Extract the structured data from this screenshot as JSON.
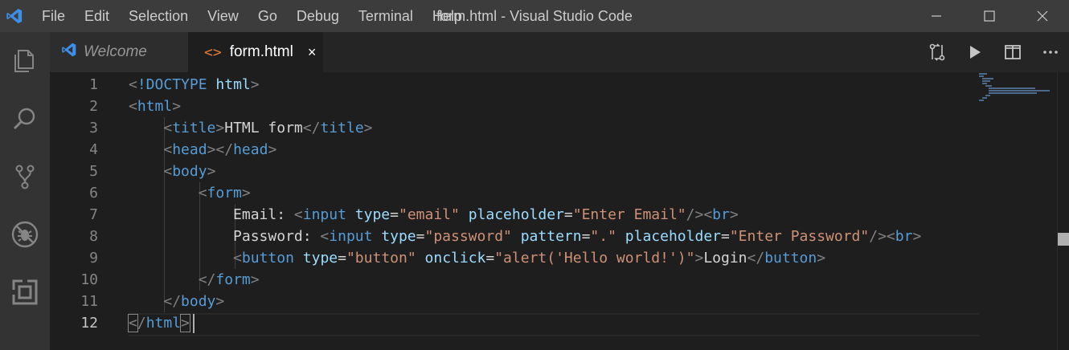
{
  "titlebar": {
    "menu": [
      "File",
      "Edit",
      "Selection",
      "View",
      "Go",
      "Debug",
      "Terminal",
      "Help"
    ],
    "title": "form.html - Visual Studio Code",
    "controls": [
      "minimize-icon",
      "maximize-icon",
      "close-icon"
    ]
  },
  "activitybar": {
    "items": [
      "explorer-icon",
      "search-icon",
      "source-control-icon",
      "debug-icon",
      "extensions-icon"
    ]
  },
  "tabs": [
    {
      "label": "Welcome",
      "icon": "vscode-logo-icon",
      "active": false
    },
    {
      "label": "form.html",
      "icon": "html-file-icon",
      "icon_glyph": "<>",
      "active": true,
      "close": "×"
    }
  ],
  "editor_actions": [
    "open-changes-icon",
    "run-icon",
    "split-editor-icon",
    "more-actions-icon"
  ],
  "editor": {
    "current_line": 12,
    "line_numbers": [
      "1",
      "2",
      "3",
      "4",
      "5",
      "6",
      "7",
      "8",
      "9",
      "10",
      "11",
      "12"
    ],
    "lines": [
      [
        [
          "punc",
          "<"
        ],
        [
          "tag",
          "!DOCTYPE"
        ],
        [
          "text",
          " "
        ],
        [
          "attr",
          "html"
        ],
        [
          "punc",
          ">"
        ]
      ],
      [
        [
          "punc",
          "<"
        ],
        [
          "tag",
          "html"
        ],
        [
          "punc",
          ">"
        ]
      ],
      [
        [
          "text",
          "    "
        ],
        [
          "punc",
          "<"
        ],
        [
          "tag",
          "title"
        ],
        [
          "punc",
          ">"
        ],
        [
          "text",
          "HTML form"
        ],
        [
          "punc",
          "</"
        ],
        [
          "tag",
          "title"
        ],
        [
          "punc",
          ">"
        ]
      ],
      [
        [
          "text",
          "    "
        ],
        [
          "punc",
          "<"
        ],
        [
          "tag",
          "head"
        ],
        [
          "punc",
          "></"
        ],
        [
          "tag",
          "head"
        ],
        [
          "punc",
          ">"
        ]
      ],
      [
        [
          "text",
          "    "
        ],
        [
          "punc",
          "<"
        ],
        [
          "tag",
          "body"
        ],
        [
          "punc",
          ">"
        ]
      ],
      [
        [
          "text",
          "        "
        ],
        [
          "punc",
          "<"
        ],
        [
          "tag",
          "form"
        ],
        [
          "punc",
          ">"
        ]
      ],
      [
        [
          "text",
          "            Email: "
        ],
        [
          "punc",
          "<"
        ],
        [
          "tag",
          "input"
        ],
        [
          "text",
          " "
        ],
        [
          "attr",
          "type"
        ],
        [
          "text",
          "="
        ],
        [
          "str",
          "\"email\""
        ],
        [
          "text",
          " "
        ],
        [
          "attr",
          "placeholder"
        ],
        [
          "text",
          "="
        ],
        [
          "str",
          "\"Enter Email\""
        ],
        [
          "punc",
          "/><"
        ],
        [
          "tag",
          "br"
        ],
        [
          "punc",
          ">"
        ]
      ],
      [
        [
          "text",
          "            Password: "
        ],
        [
          "punc",
          "<"
        ],
        [
          "tag",
          "input"
        ],
        [
          "text",
          " "
        ],
        [
          "attr",
          "type"
        ],
        [
          "text",
          "="
        ],
        [
          "str",
          "\"password\""
        ],
        [
          "text",
          " "
        ],
        [
          "attr",
          "pattern"
        ],
        [
          "text",
          "="
        ],
        [
          "str",
          "\".\""
        ],
        [
          "text",
          " "
        ],
        [
          "attr",
          "placeholder"
        ],
        [
          "text",
          "="
        ],
        [
          "str",
          "\"Enter Password\""
        ],
        [
          "punc",
          "/><"
        ],
        [
          "tag",
          "br"
        ],
        [
          "punc",
          ">"
        ]
      ],
      [
        [
          "text",
          "            "
        ],
        [
          "punc",
          "<"
        ],
        [
          "tag",
          "button"
        ],
        [
          "text",
          " "
        ],
        [
          "attr",
          "type"
        ],
        [
          "text",
          "="
        ],
        [
          "str",
          "\"button\""
        ],
        [
          "text",
          " "
        ],
        [
          "attr",
          "onclick"
        ],
        [
          "text",
          "="
        ],
        [
          "str",
          "\"alert('Hello world!')\""
        ],
        [
          "punc",
          ">"
        ],
        [
          "text",
          "Login"
        ],
        [
          "punc",
          "</"
        ],
        [
          "tag",
          "button"
        ],
        [
          "punc",
          ">"
        ]
      ],
      [
        [
          "text",
          "        "
        ],
        [
          "punc",
          "</"
        ],
        [
          "tag",
          "form"
        ],
        [
          "punc",
          ">"
        ]
      ],
      [
        [
          "text",
          "    "
        ],
        [
          "punc",
          "</"
        ],
        [
          "tag",
          "body"
        ],
        [
          "punc",
          ">"
        ]
      ],
      [
        [
          "punc",
          "<"
        ],
        [
          "punc",
          "/"
        ],
        [
          "tag",
          "html"
        ],
        [
          "punc",
          ">"
        ]
      ]
    ]
  },
  "colors": {
    "tag": "#569cd6",
    "attr": "#9cdcfe",
    "string": "#ce9178",
    "punctuation": "#808080",
    "text": "#d4d4d4",
    "html_icon": "#e37933",
    "vscode_blue": "#3c8ee6"
  }
}
